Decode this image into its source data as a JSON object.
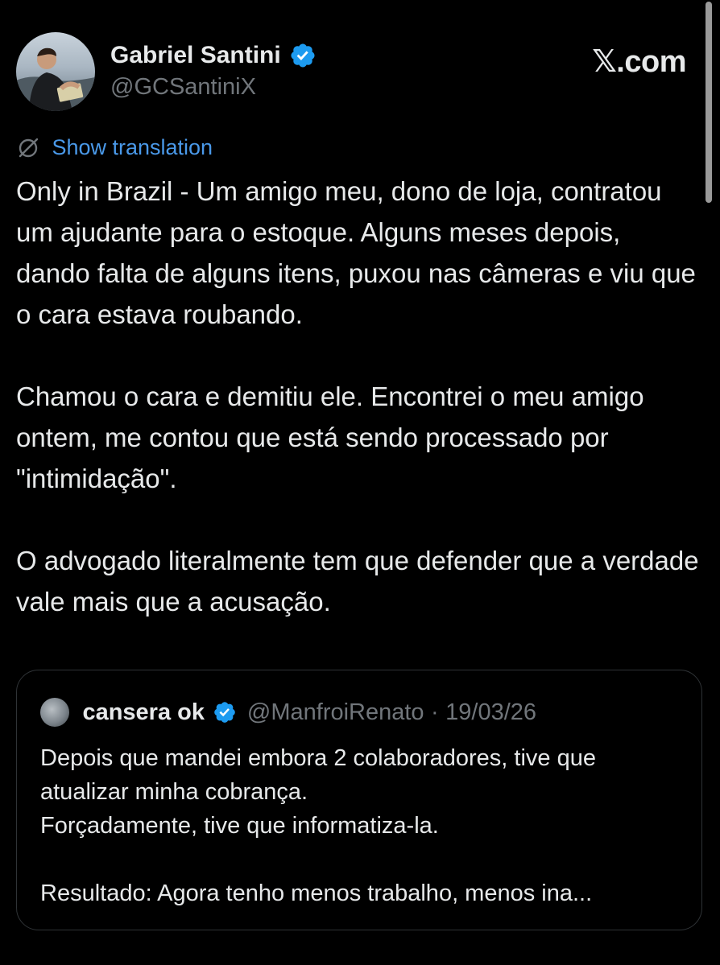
{
  "author": {
    "display_name": "Gabriel Santini",
    "handle": "@GCSantiniX",
    "verified": true,
    "avatar_icon": "profile-photo"
  },
  "site_watermark": "𝕏.com",
  "translation": {
    "label": "Show translation",
    "icon": "globe-slash-icon"
  },
  "post": {
    "paragraphs": [
      "Only in Brazil - Um amigo meu, dono de loja, contratou um ajudante para o estoque. Alguns meses depois, dando falta de alguns itens, puxou nas câmeras e viu que o cara estava roubando.",
      "Chamou o cara e demitiu ele. Encontrei o meu amigo ontem, me contou que está sendo processado por \"intimidação\".",
      "O advogado literalmente tem que defender que a verdade vale mais que a acusação."
    ]
  },
  "quoted_post": {
    "display_name": "cansera ok",
    "handle": "@ManfroiRenato",
    "separator": "·",
    "date": "19/03/26",
    "verified": true,
    "lines": [
      "Depois que mandei embora 2 colaboradores, tive que atualizar minha cobrança.",
      "Forçadamente, tive que informatiza-la.",
      "Resultado: Agora tenho menos trabalho, menos ina..."
    ]
  },
  "colors": {
    "background": "#000000",
    "text": "#e7e9ea",
    "secondary_text": "#71767b",
    "link": "#4a99e9",
    "verified_badge": "#1d9bf0",
    "card_border": "#2f3336"
  }
}
